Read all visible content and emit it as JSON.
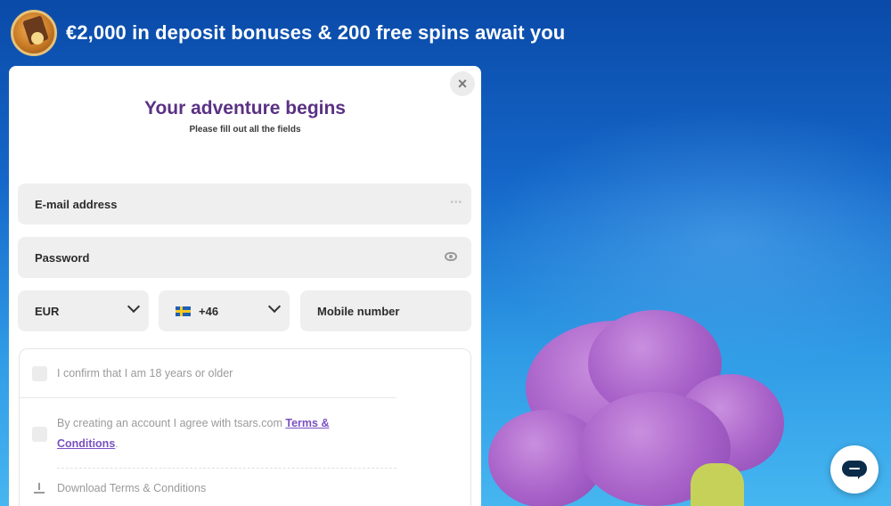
{
  "promo": {
    "headline": "€2,000 in deposit bonuses & 200 free spins await you",
    "icon": "treasure-chest-icon"
  },
  "modal": {
    "title": "Your adventure begins",
    "subtitle": "Please fill out all the fields",
    "close_label": "×"
  },
  "form": {
    "email_label": "E-mail address",
    "password_label": "Password",
    "currency_value": "EUR",
    "country_code_value": "+46",
    "country_flag": "sweden-flag-icon",
    "mobile_label": "Mobile number"
  },
  "consent": {
    "age_text": "I confirm that I am 18 years or older",
    "terms_prefix": "By creating an account I agree with tsars.com ",
    "terms_link": "Terms & Conditions",
    "terms_suffix": ".",
    "download_label": "Download Terms & Conditions"
  },
  "colors": {
    "accent_purple": "#5a3184",
    "link_purple": "#7a4fc2",
    "background_blue": "#1466c8"
  }
}
